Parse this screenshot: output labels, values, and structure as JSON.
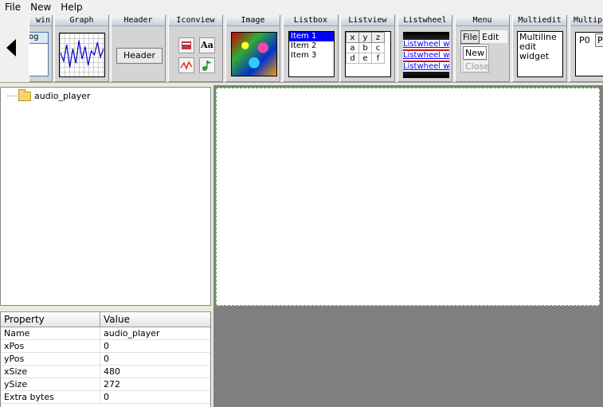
{
  "menu": {
    "items": [
      "File",
      "New",
      "Help"
    ]
  },
  "palette": {
    "tiles": {
      "win": "win",
      "graph": "Graph",
      "header": "Header",
      "iconview": "Iconview",
      "image": "Image",
      "listbox": "Listbox",
      "listview": "Listview",
      "listwheel": "Listwheel",
      "menu": "Menu",
      "multiedit": "Multiedit",
      "multipage": "Multip"
    },
    "win_preview": "og",
    "header_button": "Header",
    "iconview_icons": [
      "book-icon",
      "font-icon",
      "chart-icon",
      "music-note-icon"
    ],
    "iconview_font_glyph": "Aa",
    "listbox_items": [
      "Item 1",
      "Item 2",
      "Item 3"
    ],
    "listview": {
      "header": [
        "x",
        "y",
        "z"
      ],
      "rows": [
        [
          "a",
          "b",
          "c"
        ],
        [
          "d",
          "e",
          "f"
        ]
      ]
    },
    "listwheel_items": [
      "Listwheel wi",
      "Listwheel wi",
      "Listwheel wi"
    ],
    "menu_widget": {
      "top": [
        "File",
        "Edit"
      ],
      "sub": [
        "New",
        "Close"
      ]
    },
    "multiedit_text": [
      "Multiline",
      "edit",
      "widget"
    ],
    "multipage_tabs": [
      "P0",
      "P"
    ]
  },
  "tree": {
    "root": "audio_player"
  },
  "properties": {
    "headers": {
      "property": "Property",
      "value": "Value"
    },
    "rows": [
      {
        "name": "Name",
        "value": "audio_player"
      },
      {
        "name": "xPos",
        "value": "0"
      },
      {
        "name": "yPos",
        "value": "0"
      },
      {
        "name": "xSize",
        "value": "480"
      },
      {
        "name": "ySize",
        "value": "272"
      },
      {
        "name": "Extra bytes",
        "value": "0"
      }
    ]
  },
  "graph_series": [
    0.55,
    0.35,
    0.75,
    0.2,
    0.65,
    0.3,
    0.85,
    0.4,
    0.7,
    0.25,
    0.6,
    0.5,
    0.8,
    0.45,
    0.65
  ],
  "colors": {
    "selection": "#0000ff",
    "canvas_border": "#33cc33",
    "canvas_bg": "#808080"
  }
}
